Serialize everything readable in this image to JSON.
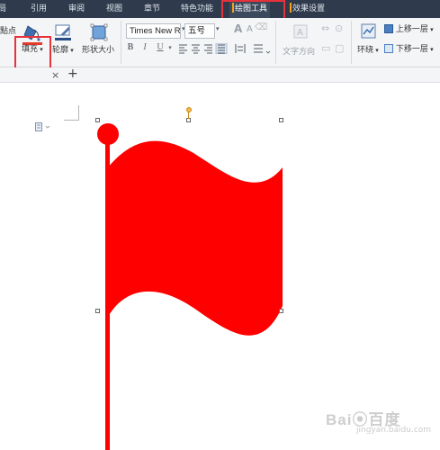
{
  "tabs": [
    {
      "label": "局",
      "active": false
    },
    {
      "label": "引用",
      "active": false
    },
    {
      "label": "审阅",
      "active": false
    },
    {
      "label": "视图",
      "active": false
    },
    {
      "label": "章节",
      "active": false
    },
    {
      "label": "特色功能",
      "active": false
    },
    {
      "label": "绘图工具",
      "active": true
    },
    {
      "label": "效果设置",
      "active": false
    }
  ],
  "ribbon": {
    "partial_label": "點点",
    "fill_label": "填充",
    "outline_label": "轮廓",
    "shape_size_label": "形状大小",
    "font_name": "Times New R",
    "font_size": "五号",
    "bold": "B",
    "italic": "I",
    "underline": "U",
    "text_direction_label": "文字方向",
    "wrap_label": "环绕",
    "move_up_label": "上移一层",
    "move_down_label": "下移一层"
  },
  "doc_tabs": {
    "close": "×",
    "add": "+"
  },
  "colors": {
    "flag_red": "#ff0000",
    "highlight_red": "#e8313a",
    "tab_bar": "#2f3b4c",
    "active_tab_accent": "#f6a21a"
  },
  "watermark": {
    "text": "Bai⦿百度",
    "sub": "jingyan.baidu.com"
  }
}
